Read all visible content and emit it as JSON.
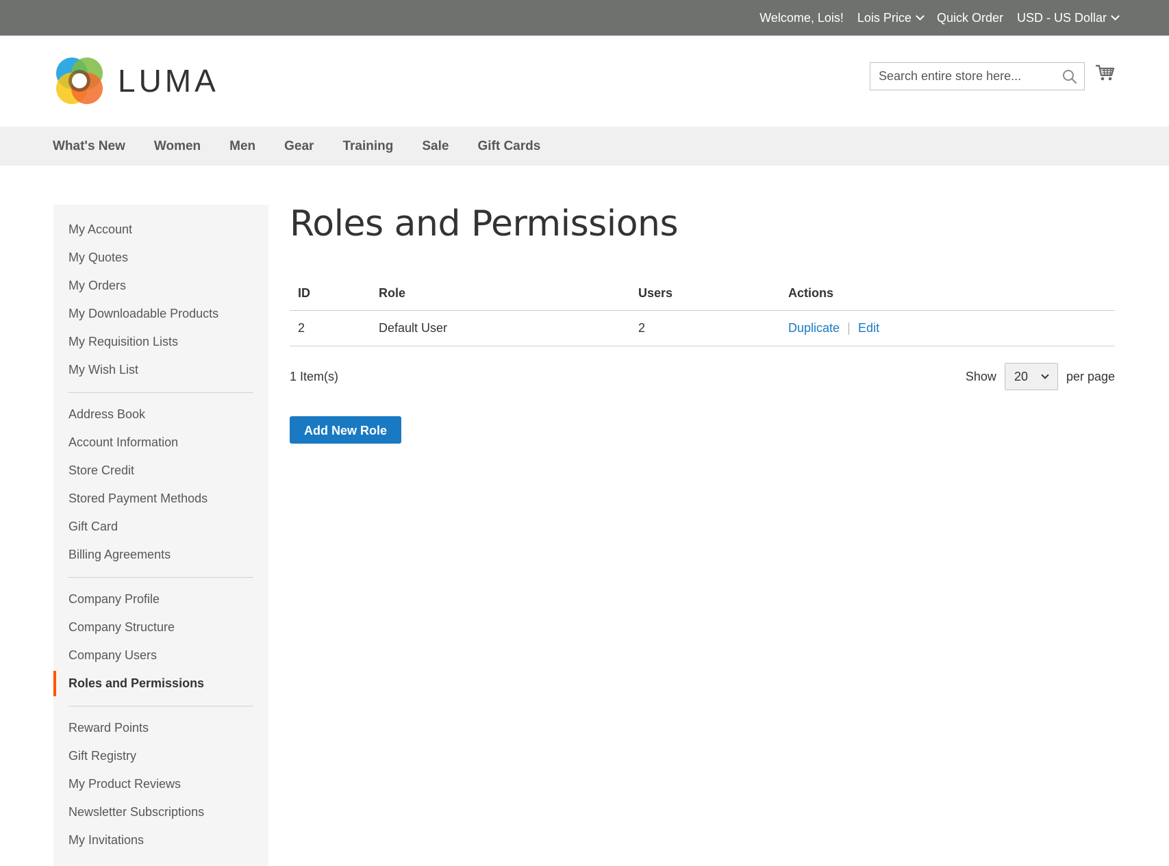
{
  "topbar": {
    "welcome": "Welcome, Lois!",
    "account_name": "Lois Price",
    "quick_order": "Quick Order",
    "currency": "USD - US Dollar"
  },
  "header": {
    "logo_text": "LUMA",
    "search_placeholder": "Search entire store here...",
    "icons": [
      "search-icon",
      "cart-icon"
    ]
  },
  "nav": {
    "items": [
      "What's New",
      "Women",
      "Men",
      "Gear",
      "Training",
      "Sale",
      "Gift Cards"
    ]
  },
  "sidebar": {
    "groups": [
      [
        "My Account",
        "My Quotes",
        "My Orders",
        "My Downloadable Products",
        "My Requisition Lists",
        "My Wish List"
      ],
      [
        "Address Book",
        "Account Information",
        "Store Credit",
        "Stored Payment Methods",
        "Gift Card",
        "Billing Agreements"
      ],
      [
        "Company Profile",
        "Company Structure",
        "Company Users",
        "Roles and Permissions"
      ],
      [
        "Reward Points",
        "Gift Registry",
        "My Product Reviews",
        "Newsletter Subscriptions",
        "My Invitations"
      ]
    ],
    "active": "Roles and Permissions",
    "accent_color": "#ff5501"
  },
  "main": {
    "title": "Roles and Permissions",
    "table": {
      "headers": [
        "ID",
        "Role",
        "Users",
        "Actions"
      ],
      "rows": [
        {
          "id": "2",
          "role": "Default User",
          "users": "2",
          "actions": [
            "Duplicate",
            "Edit"
          ]
        }
      ]
    },
    "items_count": "1 Item(s)",
    "show_label": "Show",
    "per_page_value": "20",
    "per_page_label": "per page",
    "add_button": "Add New Role",
    "link_color": "#1979c3"
  }
}
